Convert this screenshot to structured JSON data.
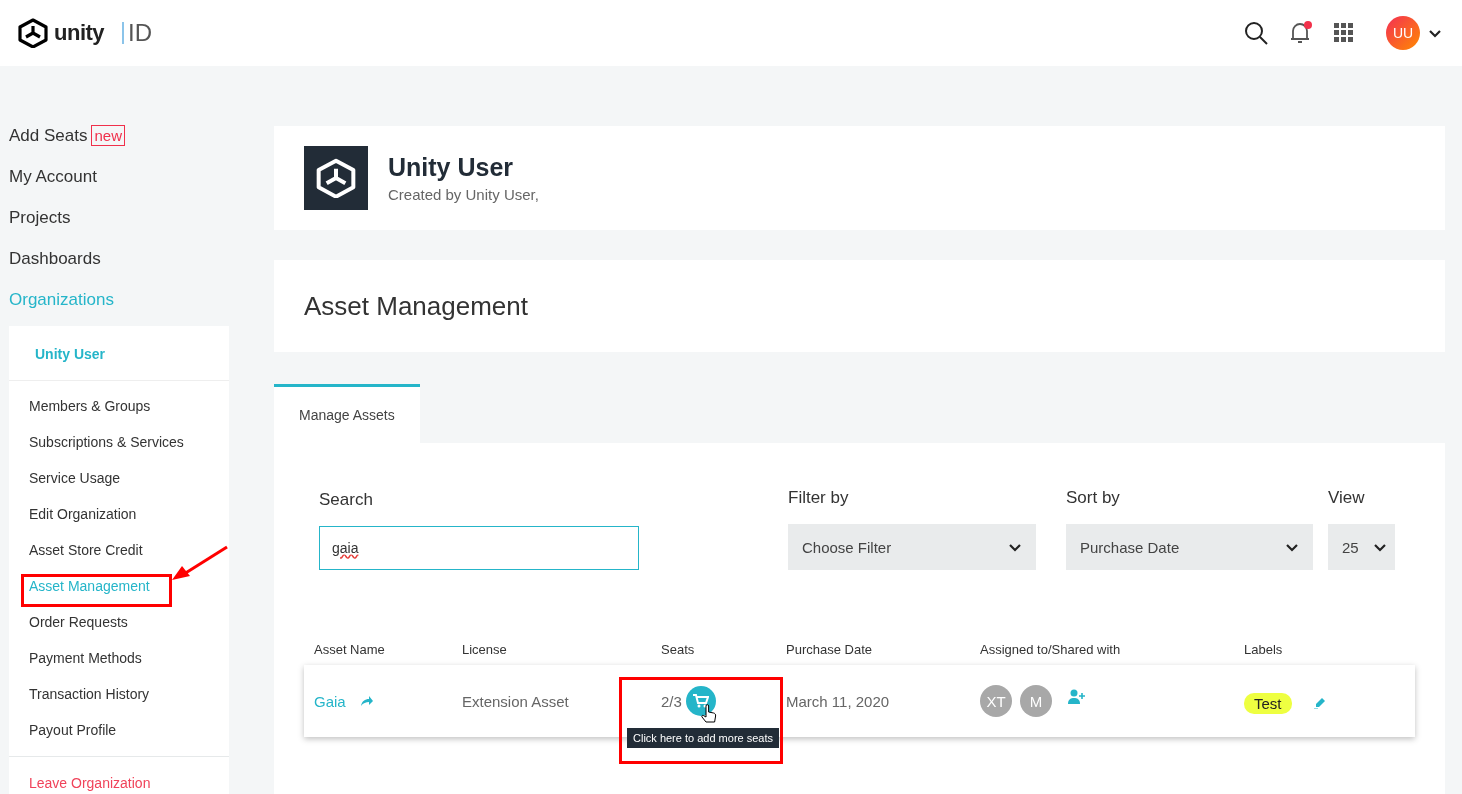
{
  "header": {
    "logo_text": "unity",
    "product": "ID",
    "notifications_unread": true,
    "avatar_initials": "UU"
  },
  "sidebar": {
    "items": [
      {
        "label": "Add Seats",
        "badge": "new",
        "selected": false
      },
      {
        "label": "My Account",
        "selected": false
      },
      {
        "label": "Projects",
        "selected": false
      },
      {
        "label": "Dashboards",
        "selected": false
      },
      {
        "label": "Organizations",
        "selected": true
      }
    ],
    "org_menu": {
      "org_name": "Unity User",
      "items": [
        {
          "label": "Members & Groups",
          "selected": false
        },
        {
          "label": "Subscriptions & Services",
          "selected": false
        },
        {
          "label": "Service Usage",
          "selected": false
        },
        {
          "label": "Edit Organization",
          "selected": false
        },
        {
          "label": "Asset Store Credit",
          "selected": false
        },
        {
          "label": "Asset Management",
          "selected": true
        },
        {
          "label": "Order Requests",
          "selected": false
        },
        {
          "label": "Payment Methods",
          "selected": false
        },
        {
          "label": "Transaction History",
          "selected": false
        },
        {
          "label": "Payout Profile",
          "selected": false
        }
      ],
      "leave_label": "Leave Organization"
    }
  },
  "org_card": {
    "name": "Unity User",
    "subtitle": "Created by Unity User,"
  },
  "page_title": "Asset Management",
  "tabs": [
    {
      "label": "Manage Assets",
      "selected": true
    }
  ],
  "controls": {
    "search": {
      "label": "Search",
      "value": "gaia"
    },
    "filter": {
      "label": "Filter by",
      "value": "Choose Filter"
    },
    "sort": {
      "label": "Sort by",
      "value": "Purchase Date"
    },
    "view": {
      "label": "View",
      "value": "25"
    }
  },
  "table": {
    "columns": [
      "Asset Name",
      "License",
      "Seats",
      "Purchase Date",
      "Assigned to/Shared with",
      "Labels"
    ],
    "rows": [
      {
        "name": "Gaia",
        "license": "Extension Asset",
        "seats": "2/3",
        "purchase_date": "March 11, 2020",
        "assignees": [
          "XT",
          "M"
        ],
        "labels": [
          {
            "text": "Test",
            "color": "#eeff41"
          }
        ]
      }
    ]
  },
  "tooltip": "Click here to add more seats"
}
